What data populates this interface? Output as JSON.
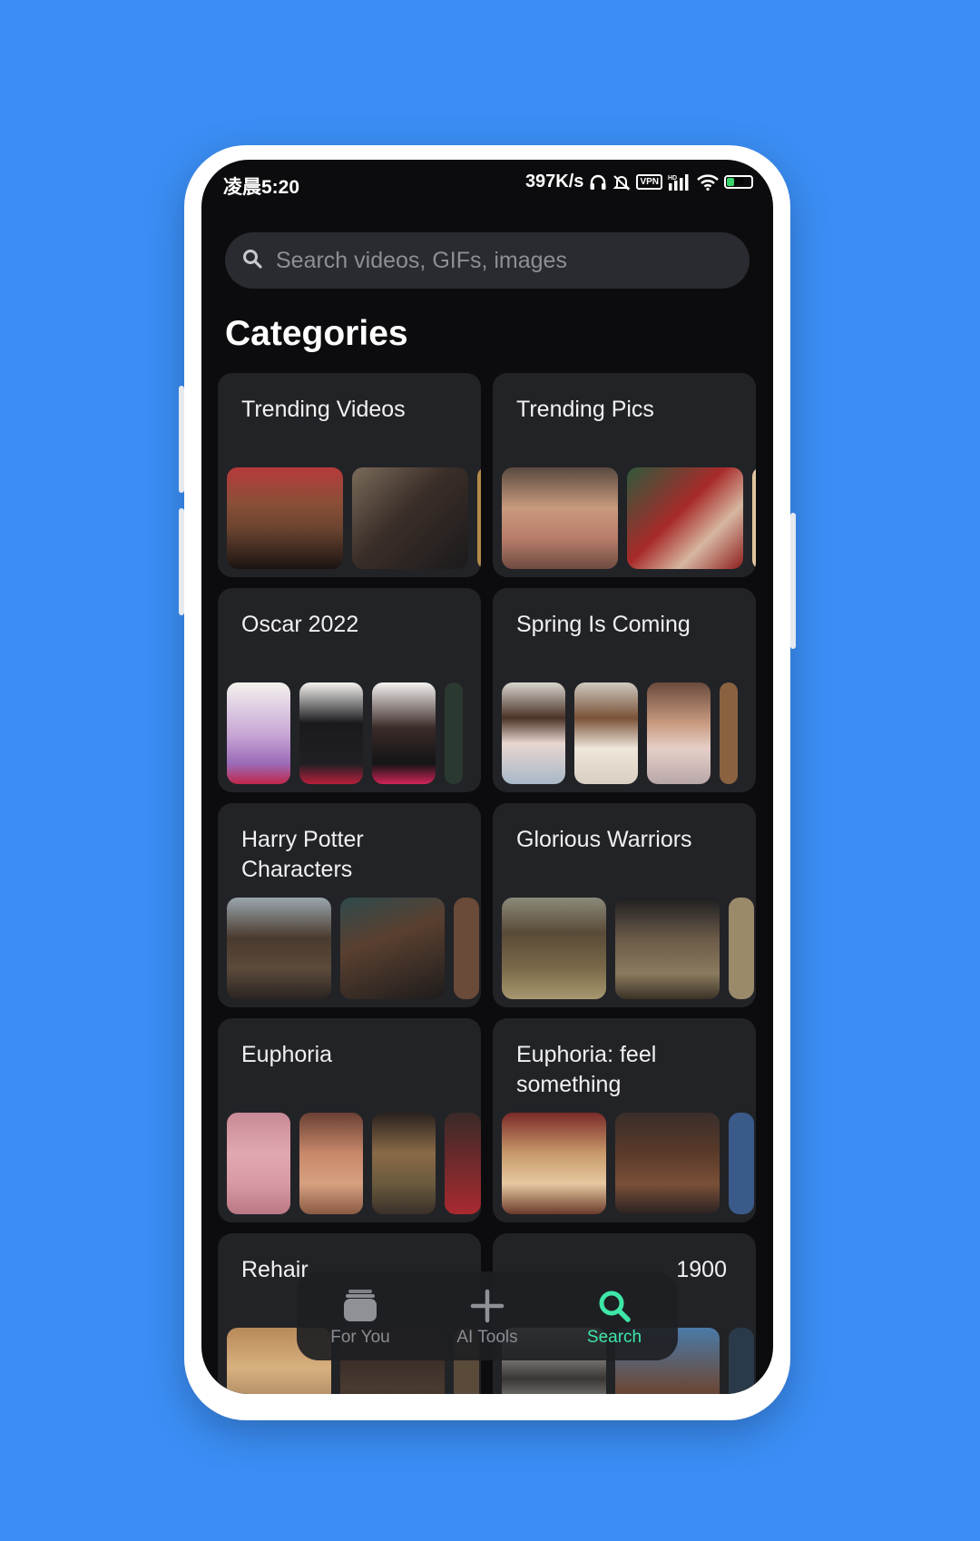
{
  "status_bar": {
    "time": "凌晨5:20",
    "net_speed": "397K/s",
    "vpn": "VPN",
    "battery": "29"
  },
  "search": {
    "placeholder": "Search videos, GIFs, images"
  },
  "section_title": "Categories",
  "categories": [
    {
      "label": "Trending Videos"
    },
    {
      "label": "Trending Pics"
    },
    {
      "label": "Oscar 2022"
    },
    {
      "label": "Spring Is Coming"
    },
    {
      "label": "Harry Potter Characters"
    },
    {
      "label": "Glorious Warriors"
    },
    {
      "label": "Euphoria"
    },
    {
      "label": "Euphoria: feel something"
    },
    {
      "label": "Rehair"
    },
    {
      "label": "1900"
    }
  ],
  "nav": {
    "items": [
      {
        "label": "For You",
        "icon": "stack-icon"
      },
      {
        "label": "AI Tools",
        "icon": "plus-icon"
      },
      {
        "label": "Search",
        "icon": "search-icon"
      }
    ],
    "active": "Search"
  },
  "colors": {
    "background": "#3B8EF5",
    "screen": "#0c0c0e",
    "card": "#222327",
    "accent": "#3ee6a8"
  }
}
